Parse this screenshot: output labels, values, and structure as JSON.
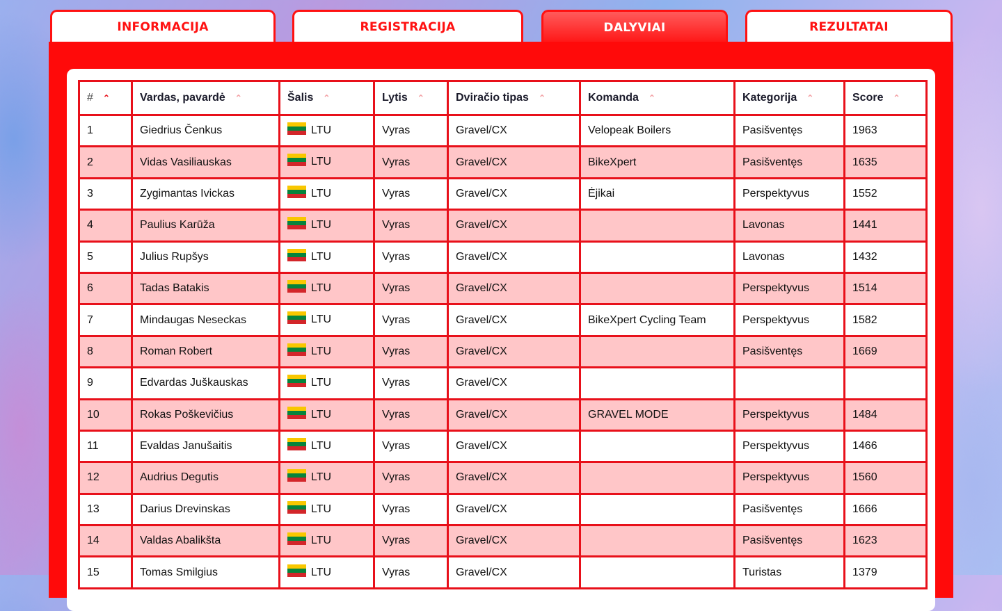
{
  "tabs": [
    {
      "label": "INFORMACIJA",
      "active": false
    },
    {
      "label": "REGISTRACIJA",
      "active": false
    },
    {
      "label": "DALYVIAI",
      "active": true
    },
    {
      "label": "REZULTATAI",
      "active": false
    }
  ],
  "table": {
    "headers": [
      "#",
      "Vardas, pavardė",
      "Šalis",
      "Lytis",
      "Dviračio tipas",
      "Komanda",
      "Kategorija",
      "Score"
    ],
    "rows": [
      [
        "1",
        "Giedrius Čenkus",
        "LTU",
        "Vyras",
        "Gravel/CX",
        "Velopeak Boilers",
        "Pasišventęs",
        "1963"
      ],
      [
        "2",
        "Vidas Vasiliauskas",
        "LTU",
        "Vyras",
        "Gravel/CX",
        "BikeXpert",
        "Pasišventęs",
        "1635"
      ],
      [
        "3",
        "Zygimantas Ivickas",
        "LTU",
        "Vyras",
        "Gravel/CX",
        "Ėjikai",
        "Perspektyvus",
        "1552"
      ],
      [
        "4",
        "Paulius Karūža",
        "LTU",
        "Vyras",
        "Gravel/CX",
        "",
        "Lavonas",
        "1441"
      ],
      [
        "5",
        "Julius Rupšys",
        "LTU",
        "Vyras",
        "Gravel/CX",
        "",
        "Lavonas",
        "1432"
      ],
      [
        "6",
        "Tadas Batakis",
        "LTU",
        "Vyras",
        "Gravel/CX",
        "",
        "Perspektyvus",
        "1514"
      ],
      [
        "7",
        "Mindaugas Neseckas",
        "LTU",
        "Vyras",
        "Gravel/CX",
        "BikeXpert Cycling Team",
        "Perspektyvus",
        "1582"
      ],
      [
        "8",
        "Roman Robert",
        "LTU",
        "Vyras",
        "Gravel/CX",
        "",
        "Pasišventęs",
        "1669"
      ],
      [
        "9",
        "Edvardas Juškauskas",
        "LTU",
        "Vyras",
        "Gravel/CX",
        "",
        "",
        ""
      ],
      [
        "10",
        "Rokas Poškevičius",
        "LTU",
        "Vyras",
        "Gravel/CX",
        "GRAVEL MODE",
        "Perspektyvus",
        "1484"
      ],
      [
        "11",
        "Evaldas Janušaitis",
        "LTU",
        "Vyras",
        "Gravel/CX",
        "",
        "Perspektyvus",
        "1466"
      ],
      [
        "12",
        "Audrius Degutis",
        "LTU",
        "Vyras",
        "Gravel/CX",
        "",
        "Perspektyvus",
        "1560"
      ],
      [
        "13",
        "Darius Drevinskas",
        "LTU",
        "Vyras",
        "Gravel/CX",
        "",
        "Pasišventęs",
        "1666"
      ],
      [
        "14",
        "Valdas Abalikšta",
        "LTU",
        "Vyras",
        "Gravel/CX",
        "",
        "Pasišventęs",
        "1623"
      ],
      [
        "15",
        "Tomas Smilgius",
        "LTU",
        "Vyras",
        "Gravel/CX",
        "",
        "Turistas",
        "1379"
      ]
    ]
  },
  "icons": {
    "sort": "chevron-up-icon",
    "flag": "lithuania-flag-icon"
  },
  "colors": {
    "accent": "#ff1111",
    "row_alt": "#ffc6c8",
    "flag": [
      "#f9c700",
      "#05843c",
      "#d3262a"
    ]
  }
}
